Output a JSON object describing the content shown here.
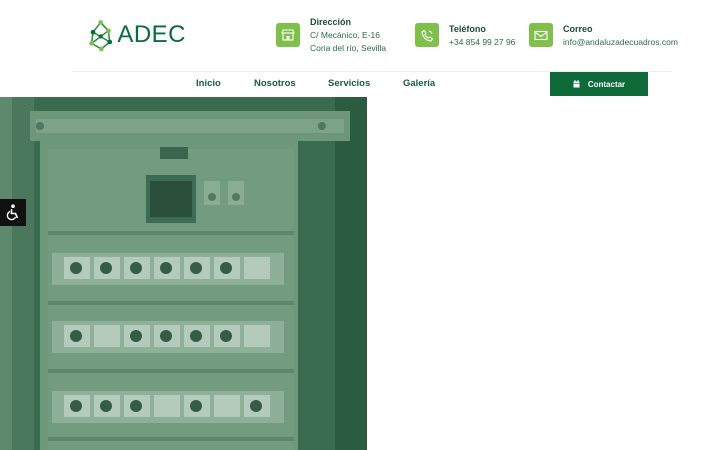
{
  "brand": {
    "name": "ADEC"
  },
  "contact": {
    "address": {
      "title": "Dirección",
      "line1": "C/ Mecánico, E-16",
      "line2": "Coria del río, Sevilla",
      "icon": "building-icon"
    },
    "phone": {
      "title": "Teléfono",
      "value": "+34 854 99 27 96",
      "icon": "phone-icon"
    },
    "email": {
      "title": "Correo",
      "value": "info@andaluzadecuadros.com",
      "icon": "envelope-icon"
    }
  },
  "nav": {
    "items": [
      {
        "label": "Inicio"
      },
      {
        "label": "Nosotros"
      },
      {
        "label": "Servicios"
      },
      {
        "label": "Galería"
      }
    ],
    "cta_label": "Contactar"
  },
  "hero": {
    "image": "electrical-cabinet-photo"
  },
  "accessibility": {
    "icon": "accessibility-icon"
  },
  "colors": {
    "brand_green": "#0f6a3a",
    "accent_green": "#7fc04b",
    "overlay_green": "#3d6f52",
    "text_dark": "#1b4d34"
  }
}
